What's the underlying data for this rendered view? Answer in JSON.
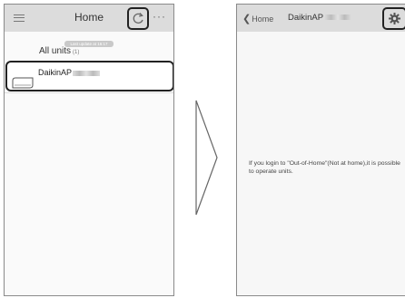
{
  "left": {
    "header": {
      "title": "Home",
      "more_label": "···"
    },
    "last_update": "Last update at 16:17",
    "all_units_label": "All units",
    "all_units_count": "(1)",
    "unit": {
      "name": "DaikinAP"
    }
  },
  "right": {
    "header": {
      "back_label": "Home",
      "title": "DaikinAP"
    },
    "info_text": "If you login to \"Out-of-Home\"(Not at home),it is possible to operate units."
  },
  "colors": {
    "header_bg": "#dcdcdc",
    "highlight_border": "#222222"
  }
}
